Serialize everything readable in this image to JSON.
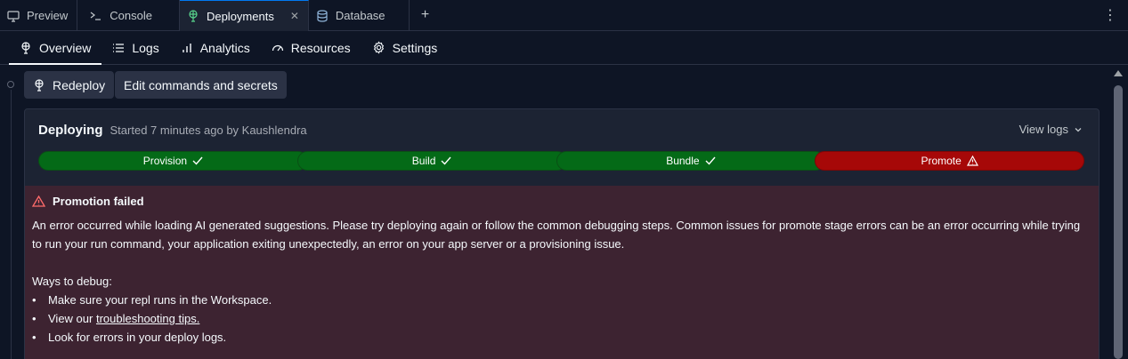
{
  "tabs": [
    {
      "label": "Preview",
      "icon": "monitor-icon"
    },
    {
      "label": "Console",
      "icon": "terminal-icon"
    },
    {
      "label": "Deployments",
      "icon": "deploy-icon",
      "active": true
    },
    {
      "label": "Database",
      "icon": "database-icon"
    }
  ],
  "subnav": [
    {
      "label": "Overview",
      "icon": "deploy-icon",
      "active": true
    },
    {
      "label": "Logs",
      "icon": "list-icon"
    },
    {
      "label": "Analytics",
      "icon": "bar-chart-icon"
    },
    {
      "label": "Resources",
      "icon": "gauge-icon"
    },
    {
      "label": "Settings",
      "icon": "gear-icon"
    }
  ],
  "actions": {
    "redeploy": "Redeploy",
    "edit": "Edit commands and secrets"
  },
  "deployment": {
    "status": "Deploying",
    "meta": "Started 7 minutes ago by Kaushlendra",
    "view_logs": "View logs",
    "stages": [
      {
        "label": "Provision",
        "state": "done"
      },
      {
        "label": "Build",
        "state": "done"
      },
      {
        "label": "Bundle",
        "state": "done"
      },
      {
        "label": "Promote",
        "state": "failed"
      }
    ]
  },
  "error": {
    "title": "Promotion failed",
    "message": "An error occurred while loading AI generated suggestions. Please try deploying again or follow the common debugging steps. Common issues for promote stage errors can be an error occurring while trying to run your run command, your application exiting unexpectedly, an error on your app server or a provisioning issue.",
    "debug_heading": "Ways to debug:",
    "debug_items": [
      {
        "text": "Make sure your repl runs in the Workspace."
      },
      {
        "prefix": "View our ",
        "link": "troubleshooting tips."
      },
      {
        "text": "Look for errors in your deploy logs."
      }
    ]
  },
  "colors": {
    "success": "#046a17",
    "failure": "#a60808",
    "error_bg": "#3d2331"
  }
}
